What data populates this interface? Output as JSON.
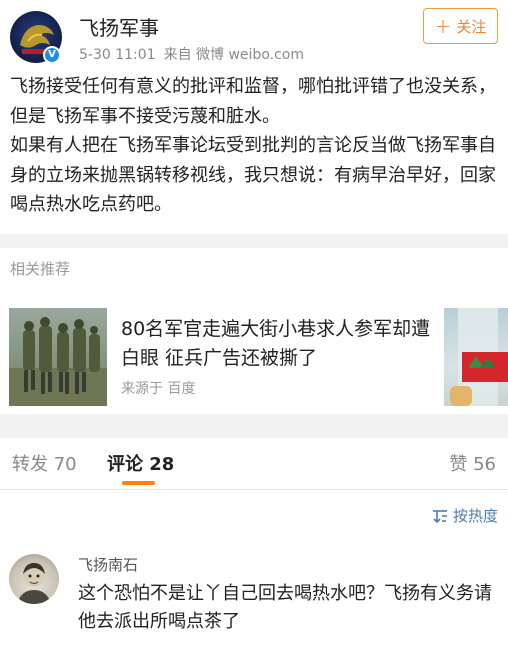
{
  "post": {
    "author": "飞扬军事",
    "meta_time": "5-30 11:01",
    "meta_source": "来自 微博 weibo.com",
    "follow_label": "关注",
    "body": [
      "飞扬接受任何有意义的批评和监督，哪怕批评错了也没关系，但是飞扬军事不接受污蔑和脏水。",
      "如果有人把在飞扬军事论坛受到批判的言论反当做飞扬军事自身的立场来抛黑锅转移视线，我只想说：有病早治早好，回家喝点热水吃点药吧。"
    ]
  },
  "recommend": {
    "section_title": "相关推荐",
    "item": {
      "headline": "80名军官走遍大街小巷求人参军却遭白眼 征兵广告还被撕了",
      "source": "来源于 百度"
    }
  },
  "tabs": [
    {
      "label": "转发 70"
    },
    {
      "label": "评论 28"
    },
    {
      "label": "赞 56"
    }
  ],
  "sort_label": "按热度",
  "comment": {
    "author": "飞扬南石",
    "text": "这个恐怕不是让丫自己回去喝热水吧？飞扬有义务请他去派出所喝点茶了"
  },
  "colors": {
    "accent": "#ff8200",
    "follow": "#f08232",
    "link": "#507daf",
    "verified": "#1f8ee8"
  }
}
